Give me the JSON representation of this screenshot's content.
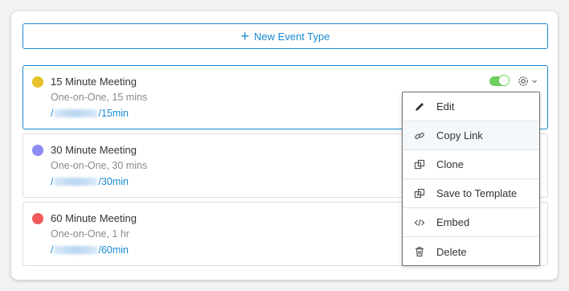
{
  "new_event_button": {
    "label": "New Event Type",
    "color": "#1a8ad1"
  },
  "events": [
    {
      "title": "15 Minute Meeting",
      "subtitle": "One-on-One, 15 mins",
      "link_prefix": "/",
      "link_suffix": "/15min",
      "color": "#e6c12e",
      "enabled": true
    },
    {
      "title": "30 Minute Meeting",
      "subtitle": "One-on-One, 30 mins",
      "link_prefix": "/",
      "link_suffix": "/30min",
      "color": "#8c8cf5",
      "enabled": true
    },
    {
      "title": "60 Minute Meeting",
      "subtitle": "One-on-One, 1 hr",
      "link_prefix": "/",
      "link_suffix": "/60min",
      "color": "#f05a5a",
      "enabled": true
    }
  ],
  "settings_menu": {
    "items": [
      {
        "label": "Edit",
        "icon": "pencil-icon"
      },
      {
        "label": "Copy Link",
        "icon": "link-icon"
      },
      {
        "label": "Clone",
        "icon": "clone-icon"
      },
      {
        "label": "Save to Template",
        "icon": "template-icon"
      },
      {
        "label": "Embed",
        "icon": "code-icon"
      },
      {
        "label": "Delete",
        "icon": "trash-icon"
      }
    ]
  }
}
